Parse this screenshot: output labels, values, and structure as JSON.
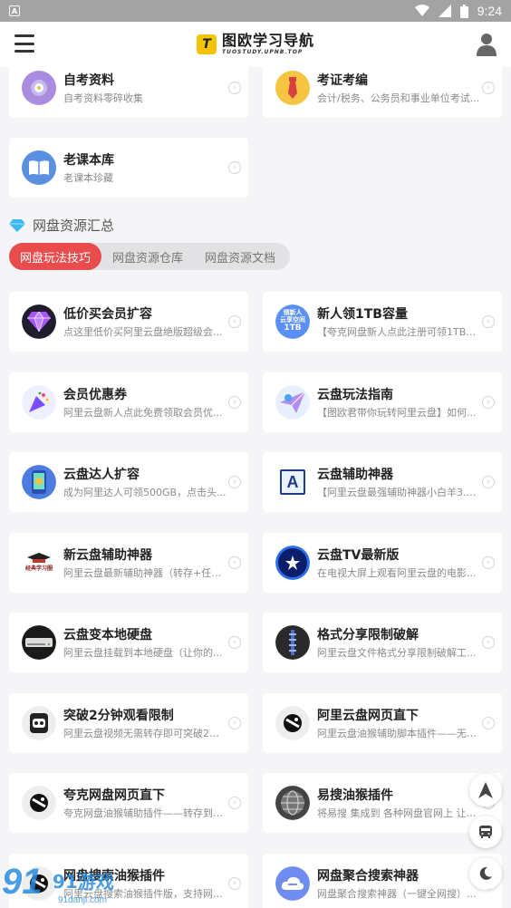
{
  "status_bar": {
    "left_icon": "A",
    "time": "9:24"
  },
  "app_bar": {
    "logo_title": "图欧学习导航",
    "logo_sub": "TUOSTUDY.UPNB.TOP",
    "logo_mark": "T"
  },
  "top_cards": [
    {
      "title": "自考资料",
      "desc": "自考资料零碎收集",
      "icon": "gear-flower-icon",
      "color": "#a98be0"
    },
    {
      "title": "考证考编",
      "desc": "会计/税务、公务员和事业单位考试...",
      "icon": "tie-icon",
      "color": "#f5c542"
    },
    {
      "title": "老课本库",
      "desc": "老课本珍藏",
      "icon": "book-icon",
      "color": "#5b8fe0"
    }
  ],
  "section": {
    "title": "网盘资源汇总",
    "icon": "diamond-icon"
  },
  "tabs": [
    {
      "label": "网盘玩法技巧",
      "active": true
    },
    {
      "label": "网盘资源仓库",
      "active": false
    },
    {
      "label": "网盘资源文档",
      "active": false
    }
  ],
  "grid_cards": [
    {
      "title": "低价买会员扩容",
      "desc": "点这里低价买阿里云盘绝版超级会...",
      "icon": "purple-gem-icon"
    },
    {
      "title": "新人领1TB容量",
      "desc": "【夸克网盘新人点此注册可领1TB容...",
      "icon": "cloud-1tb-icon"
    },
    {
      "title": "会员优惠券",
      "desc": "阿里云盘新人点此免费领取会员优...",
      "icon": "party-popper-icon"
    },
    {
      "title": "云盘玩法指南",
      "desc": "【图欧君带你玩转阿里云盘】如何...",
      "icon": "paper-plane-icon"
    },
    {
      "title": "云盘达人扩容",
      "desc": "成为阿里达人可领500GB，点击头...",
      "icon": "phone-icon"
    },
    {
      "title": "云盘辅助神器",
      "desc": "【阿里云盘最强辅助神器小白羊3.9...",
      "icon": "letter-a-icon"
    },
    {
      "title": "新云盘辅助神器",
      "desc": "阿里云盘最新辅助神器（转存+任务...",
      "icon": "graduation-logo-icon"
    },
    {
      "title": "云盘TV最新版",
      "desc": "在电视大屏上观看阿里云盘的电影...",
      "icon": "tv-star-icon"
    },
    {
      "title": "云盘变本地硬盘",
      "desc": "阿里云盘挂载到本地硬盘（让你的...",
      "icon": "hard-drive-icon"
    },
    {
      "title": "格式分享限制破解",
      "desc": "阿里云盘文件格式分享限制破解工...",
      "icon": "zipper-icon"
    },
    {
      "title": "突破2分钟观看限制",
      "desc": "阿里云盘视频无需转存即可突破2分...",
      "icon": "robot-icon"
    },
    {
      "title": "阿里云盘网页直下",
      "desc": "阿里云盘油猴辅助脚本插件——无需...",
      "icon": "tampermonkey-icon"
    },
    {
      "title": "夸克网盘网页直下",
      "desc": "夸克网盘油猴辅助插件——转存到自...",
      "icon": "tampermonkey-icon"
    },
    {
      "title": "易搜油猴插件",
      "desc": "将易搜 集成到 各种网盘官网上 让搜...",
      "icon": "globe-icon"
    },
    {
      "title": "网盘搜索油猴插件",
      "desc": "阿里云盘搜索油猴插件版，支持网...",
      "icon": "tampermonkey-icon"
    },
    {
      "title": "网盘聚合搜索神器",
      "desc": "网盘聚合搜索神器（一键全网搜）...",
      "icon": "cloud-search-icon"
    }
  ],
  "fabs": [
    {
      "name": "scroll-top-button",
      "icon": "navigation-arrow-icon"
    },
    {
      "name": "bus-button",
      "icon": "bus-icon"
    },
    {
      "name": "theme-toggle-button",
      "icon": "moon-icon"
    }
  ],
  "watermark": {
    "text": "91游戏",
    "sub": "91danji.com"
  },
  "colors": {
    "accent": "#e84c4c",
    "background": "#f5f5f7",
    "logo": "#f5c400"
  }
}
